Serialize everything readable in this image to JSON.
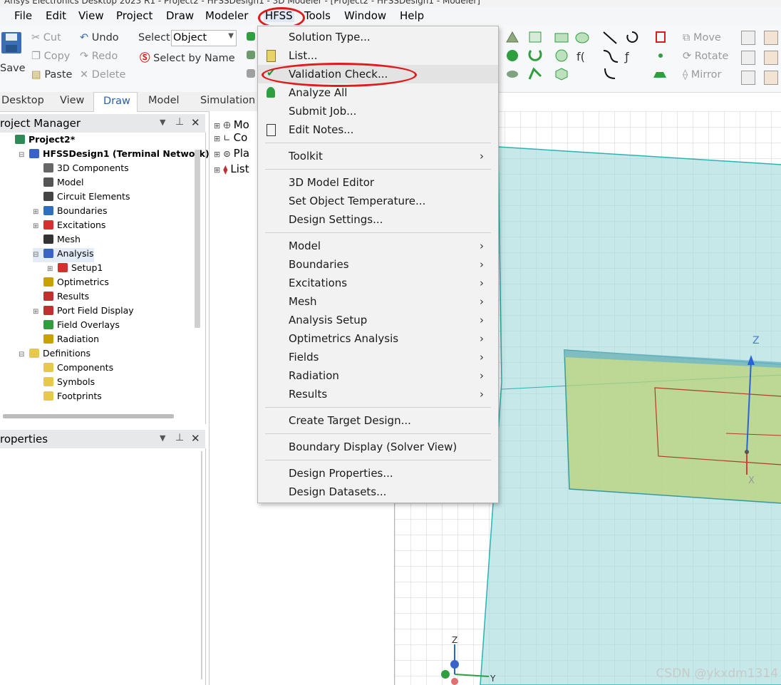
{
  "window": {
    "title_fragment": "Ansys Electronics Desktop 2023 R1 - Project2 - HFSSDesign1 - 3D Modeler - [Project2 - HFSSDesign1 - Modeler]"
  },
  "menubar": [
    "File",
    "Edit",
    "View",
    "Project",
    "Draw",
    "Modeler",
    "HFSS",
    "Tools",
    "Window",
    "Help"
  ],
  "toolbar": {
    "save": "Save",
    "cut": "Cut",
    "copy": "Copy",
    "paste": "Paste",
    "undo": "Undo",
    "redo": "Redo",
    "delete": "Delete",
    "select_label": "Select:",
    "select_value": "Object",
    "select_by_name": "Select by Name",
    "move": "Move",
    "rotate": "Rotate",
    "mirror": "Mirror"
  },
  "tabs": [
    "Desktop",
    "View",
    "Draw",
    "Model",
    "Simulation"
  ],
  "project_manager": {
    "title": "roject Manager",
    "tree": [
      {
        "label": "Project2*",
        "level": 0,
        "bold": true,
        "icon": "project-icon",
        "color": "#2e8b57",
        "expander": ""
      },
      {
        "label": "HFSSDesign1 (Terminal Network)*",
        "level": 1,
        "bold": true,
        "icon": "hfss-design-icon",
        "color": "#3a63c8",
        "expander": "-"
      },
      {
        "label": "3D Components",
        "level": 2,
        "bold": false,
        "icon": "components-icon",
        "color": "#666666",
        "expander": ""
      },
      {
        "label": "Model",
        "level": 2,
        "bold": false,
        "icon": "model-icon",
        "color": "#555555",
        "expander": ""
      },
      {
        "label": "Circuit Elements",
        "level": 2,
        "bold": false,
        "icon": "circuit-icon",
        "color": "#444444",
        "expander": ""
      },
      {
        "label": "Boundaries",
        "level": 2,
        "bold": false,
        "icon": "boundaries-icon",
        "color": "#2f6fbf",
        "expander": "+"
      },
      {
        "label": "Excitations",
        "level": 2,
        "bold": false,
        "icon": "excitations-icon",
        "color": "#d43030",
        "expander": "+"
      },
      {
        "label": "Mesh",
        "level": 2,
        "bold": false,
        "icon": "mesh-icon",
        "color": "#333333",
        "expander": ""
      },
      {
        "label": "Analysis",
        "level": 2,
        "bold": false,
        "icon": "analysis-icon",
        "color": "#3a63c8",
        "expander": "-",
        "highlight": true
      },
      {
        "label": "Setup1",
        "level": 3,
        "bold": false,
        "icon": "setup-icon",
        "color": "#d43030",
        "expander": "+"
      },
      {
        "label": "Optimetrics",
        "level": 2,
        "bold": false,
        "icon": "optimetrics-icon",
        "color": "#c8a200",
        "expander": ""
      },
      {
        "label": "Results",
        "level": 2,
        "bold": false,
        "icon": "results-icon",
        "color": "#c03030",
        "expander": ""
      },
      {
        "label": "Port Field Display",
        "level": 2,
        "bold": false,
        "icon": "port-field-icon",
        "color": "#c03030",
        "expander": "+"
      },
      {
        "label": "Field Overlays",
        "level": 2,
        "bold": false,
        "icon": "field-overlays-icon",
        "color": "#2e9e3e",
        "expander": ""
      },
      {
        "label": "Radiation",
        "level": 2,
        "bold": false,
        "icon": "radiation-icon",
        "color": "#c8a200",
        "expander": ""
      },
      {
        "label": "Definitions",
        "level": 1,
        "bold": false,
        "icon": "folder-icon",
        "color": "#e6c84a",
        "expander": "-"
      },
      {
        "label": "Components",
        "level": 2,
        "bold": false,
        "icon": "folder-icon",
        "color": "#e6c84a",
        "expander": ""
      },
      {
        "label": "Symbols",
        "level": 2,
        "bold": false,
        "icon": "folder-icon",
        "color": "#e6c84a",
        "expander": ""
      },
      {
        "label": "Footprints",
        "level": 2,
        "bold": false,
        "icon": "folder-icon",
        "color": "#e6c84a",
        "expander": ""
      }
    ]
  },
  "properties": {
    "title": "roperties"
  },
  "model_tree": [
    "Mo",
    "Co",
    "Pla",
    "List"
  ],
  "hfss_menu": {
    "groups": [
      [
        {
          "label": "Solution Type...",
          "icon": "",
          "arrow": false
        },
        {
          "label": "List...",
          "icon": "list-icon",
          "arrow": false
        },
        {
          "label": "Validation Check...",
          "icon": "validation-check-icon",
          "arrow": false,
          "highlight": true
        },
        {
          "label": "Analyze All",
          "icon": "analyze-all-icon",
          "arrow": false
        },
        {
          "label": "Submit Job...",
          "icon": "",
          "arrow": false
        },
        {
          "label": "Edit Notes...",
          "icon": "edit-notes-icon",
          "arrow": false
        }
      ],
      [
        {
          "label": "Toolkit",
          "icon": "",
          "arrow": true
        }
      ],
      [
        {
          "label": "3D Model Editor",
          "icon": "",
          "arrow": false
        },
        {
          "label": "Set Object Temperature...",
          "icon": "",
          "arrow": false
        },
        {
          "label": "Design Settings...",
          "icon": "",
          "arrow": false
        }
      ],
      [
        {
          "label": "Model",
          "icon": "",
          "arrow": true
        },
        {
          "label": "Boundaries",
          "icon": "",
          "arrow": true
        },
        {
          "label": "Excitations",
          "icon": "",
          "arrow": true
        },
        {
          "label": "Mesh",
          "icon": "",
          "arrow": true
        },
        {
          "label": "Analysis Setup",
          "icon": "",
          "arrow": true
        },
        {
          "label": "Optimetrics Analysis",
          "icon": "",
          "arrow": true
        },
        {
          "label": "Fields",
          "icon": "",
          "arrow": true
        },
        {
          "label": "Radiation",
          "icon": "",
          "arrow": true
        },
        {
          "label": "Results",
          "icon": "",
          "arrow": true
        }
      ],
      [
        {
          "label": "Create Target Design...",
          "icon": "",
          "arrow": false
        }
      ],
      [
        {
          "label": "Boundary Display (Solver View)",
          "icon": "",
          "arrow": false
        }
      ],
      [
        {
          "label": "Design Properties...",
          "icon": "",
          "arrow": false
        },
        {
          "label": "Design Datasets...",
          "icon": "",
          "arrow": false
        }
      ]
    ]
  },
  "viewport": {
    "axis_z": "Z",
    "axis_x": "X",
    "triad_z": "Z",
    "triad_y": "Y"
  },
  "watermark": "CSDN @ykxdm1314",
  "colors": {
    "annotation_red": "#e01b1b",
    "selection_blue": "#cde3f7",
    "grid": "#c9d3dc"
  }
}
